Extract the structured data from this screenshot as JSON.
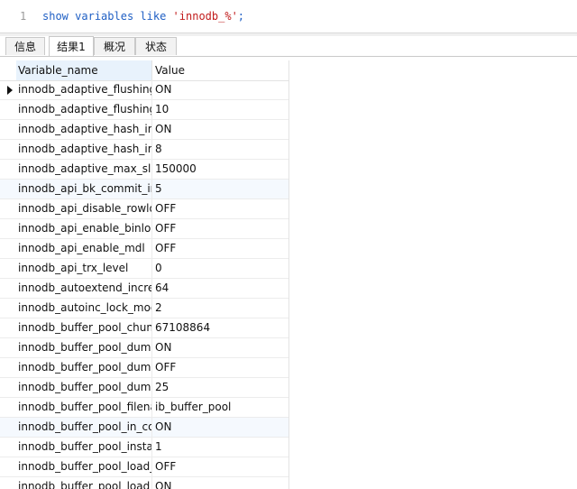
{
  "editor": {
    "line_number": "1",
    "query": {
      "kw1": "show",
      "kw2": "variables",
      "kw3": "like",
      "string": "'innodb_%'",
      "terminator": ";"
    }
  },
  "tabs": [
    {
      "label": "信息",
      "active": false
    },
    {
      "label": "结果1",
      "active": true
    },
    {
      "label": "概况",
      "active": false
    },
    {
      "label": "状态",
      "active": false
    }
  ],
  "grid": {
    "columns": [
      "Variable_name",
      "Value"
    ],
    "rows": [
      {
        "name": "innodb_adaptive_flushing",
        "value": "ON"
      },
      {
        "name": "innodb_adaptive_flushing_lwm",
        "value": "10"
      },
      {
        "name": "innodb_adaptive_hash_index",
        "value": "ON"
      },
      {
        "name": "innodb_adaptive_hash_index_parts",
        "value": "8"
      },
      {
        "name": "innodb_adaptive_max_sleep_delay",
        "value": "150000"
      },
      {
        "name": "innodb_api_bk_commit_interval",
        "value": "5"
      },
      {
        "name": "innodb_api_disable_rowlock",
        "value": "OFF"
      },
      {
        "name": "innodb_api_enable_binlog",
        "value": "OFF"
      },
      {
        "name": "innodb_api_enable_mdl",
        "value": "OFF"
      },
      {
        "name": "innodb_api_trx_level",
        "value": "0"
      },
      {
        "name": "innodb_autoextend_increment",
        "value": "64"
      },
      {
        "name": "innodb_autoinc_lock_mode",
        "value": "2"
      },
      {
        "name": "innodb_buffer_pool_chunk_size",
        "value": "67108864"
      },
      {
        "name": "innodb_buffer_pool_dump_at_shutdown",
        "value": "ON"
      },
      {
        "name": "innodb_buffer_pool_dump_now",
        "value": "OFF"
      },
      {
        "name": "innodb_buffer_pool_dump_pct",
        "value": "25"
      },
      {
        "name": "innodb_buffer_pool_filename",
        "value": "ib_buffer_pool"
      },
      {
        "name": "innodb_buffer_pool_in_core_file",
        "value": "ON"
      },
      {
        "name": "innodb_buffer_pool_instances",
        "value": "1"
      },
      {
        "name": "innodb_buffer_pool_load_abort",
        "value": "OFF"
      },
      {
        "name": "innodb_buffer_pool_load_at_startup",
        "value": "ON"
      }
    ]
  },
  "colors": {
    "keyword": "#1f5fc4",
    "string": "#c11b1b",
    "header_highlight": "#e8f2fc",
    "alt_row": "#f5f9fe"
  },
  "icons": {
    "current_row": "row-pointer-triangle-icon"
  }
}
